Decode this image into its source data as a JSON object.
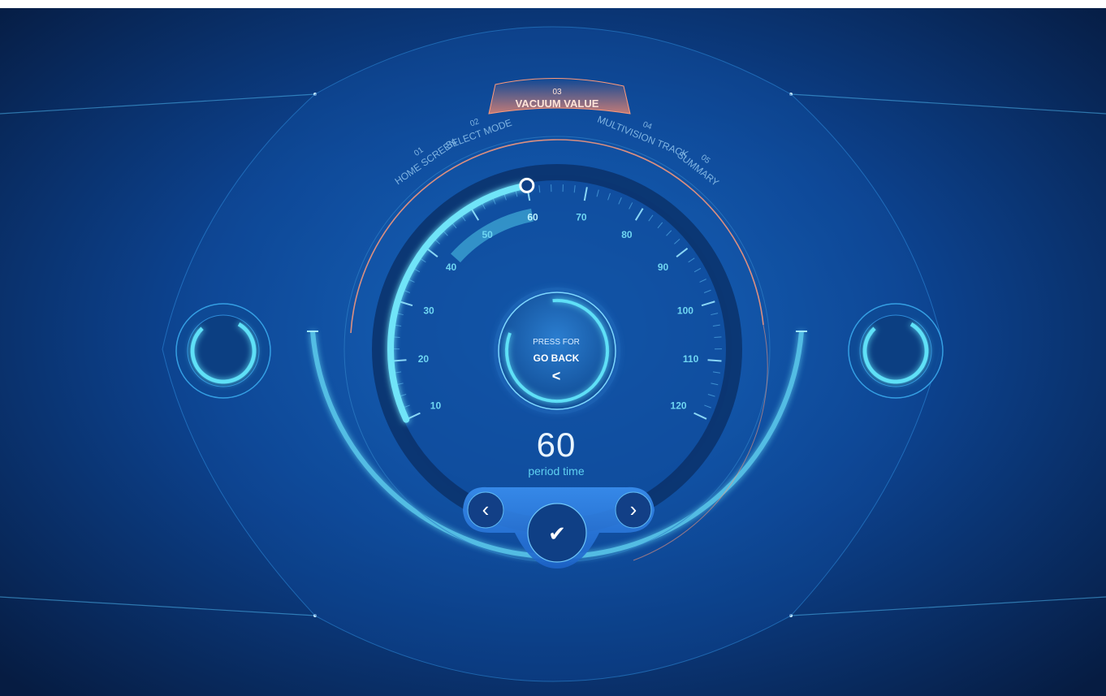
{
  "steps": [
    {
      "num": "01",
      "label": "HOME SCREEN",
      "active": false
    },
    {
      "num": "02",
      "label": "SELECT MODE",
      "active": false
    },
    {
      "num": "03",
      "label": "VACUUM VALUE",
      "active": true
    },
    {
      "num": "04",
      "label": "MULTIVISION TRACK",
      "active": false
    },
    {
      "num": "05",
      "label": "SUMMARY",
      "active": false
    }
  ],
  "gauge": {
    "ticks": [
      "10",
      "20",
      "30",
      "40",
      "50",
      "60",
      "70",
      "80",
      "90",
      "100",
      "110",
      "120"
    ],
    "min": 10,
    "max": 120,
    "value": 60
  },
  "center_button": {
    "line1": "PRESS FOR",
    "line2": "GO BACK",
    "arrow": "<"
  },
  "readout": {
    "value": "60",
    "label": "period time"
  },
  "controls": {
    "prev": "‹",
    "confirm": "✔",
    "next": "›"
  },
  "colors": {
    "accent": "#4fd6f2",
    "active_step": "#ff8a6a",
    "background": "#0b3a7a"
  }
}
